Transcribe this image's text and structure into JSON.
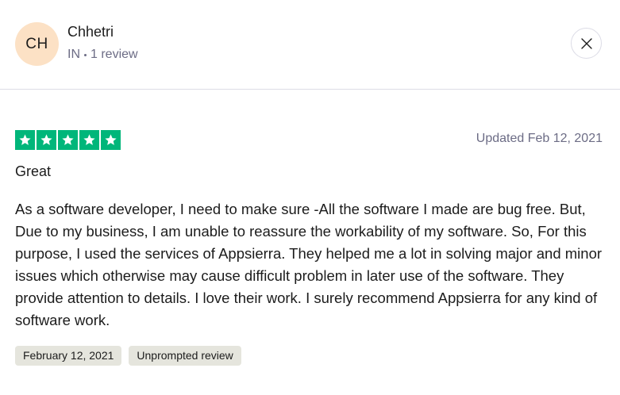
{
  "reviewer": {
    "initials": "CH",
    "name": "Chhetri",
    "country": "IN",
    "review_count": "1 review",
    "avatar_color": "#fce1c5"
  },
  "close_button": {
    "icon": "close-icon"
  },
  "review": {
    "rating": 5,
    "rating_max": 5,
    "star_color": "#00b67a",
    "updated": "Updated Feb 12, 2021",
    "title": "Great",
    "body": "As a software developer, I need to make sure -All the software I made are bug free. But, Due to my business, I am unable to reassure the workability of my software. So, For this purpose, I used the services of Appsierra. They helped me a lot in solving major and minor issues which otherwise may cause difficult problem in later use of the software. They provide attention to details. I love their work. I surely recommend Appsierra for any kind of software work."
  },
  "tags": [
    "February 12, 2021",
    "Unprompted review"
  ]
}
